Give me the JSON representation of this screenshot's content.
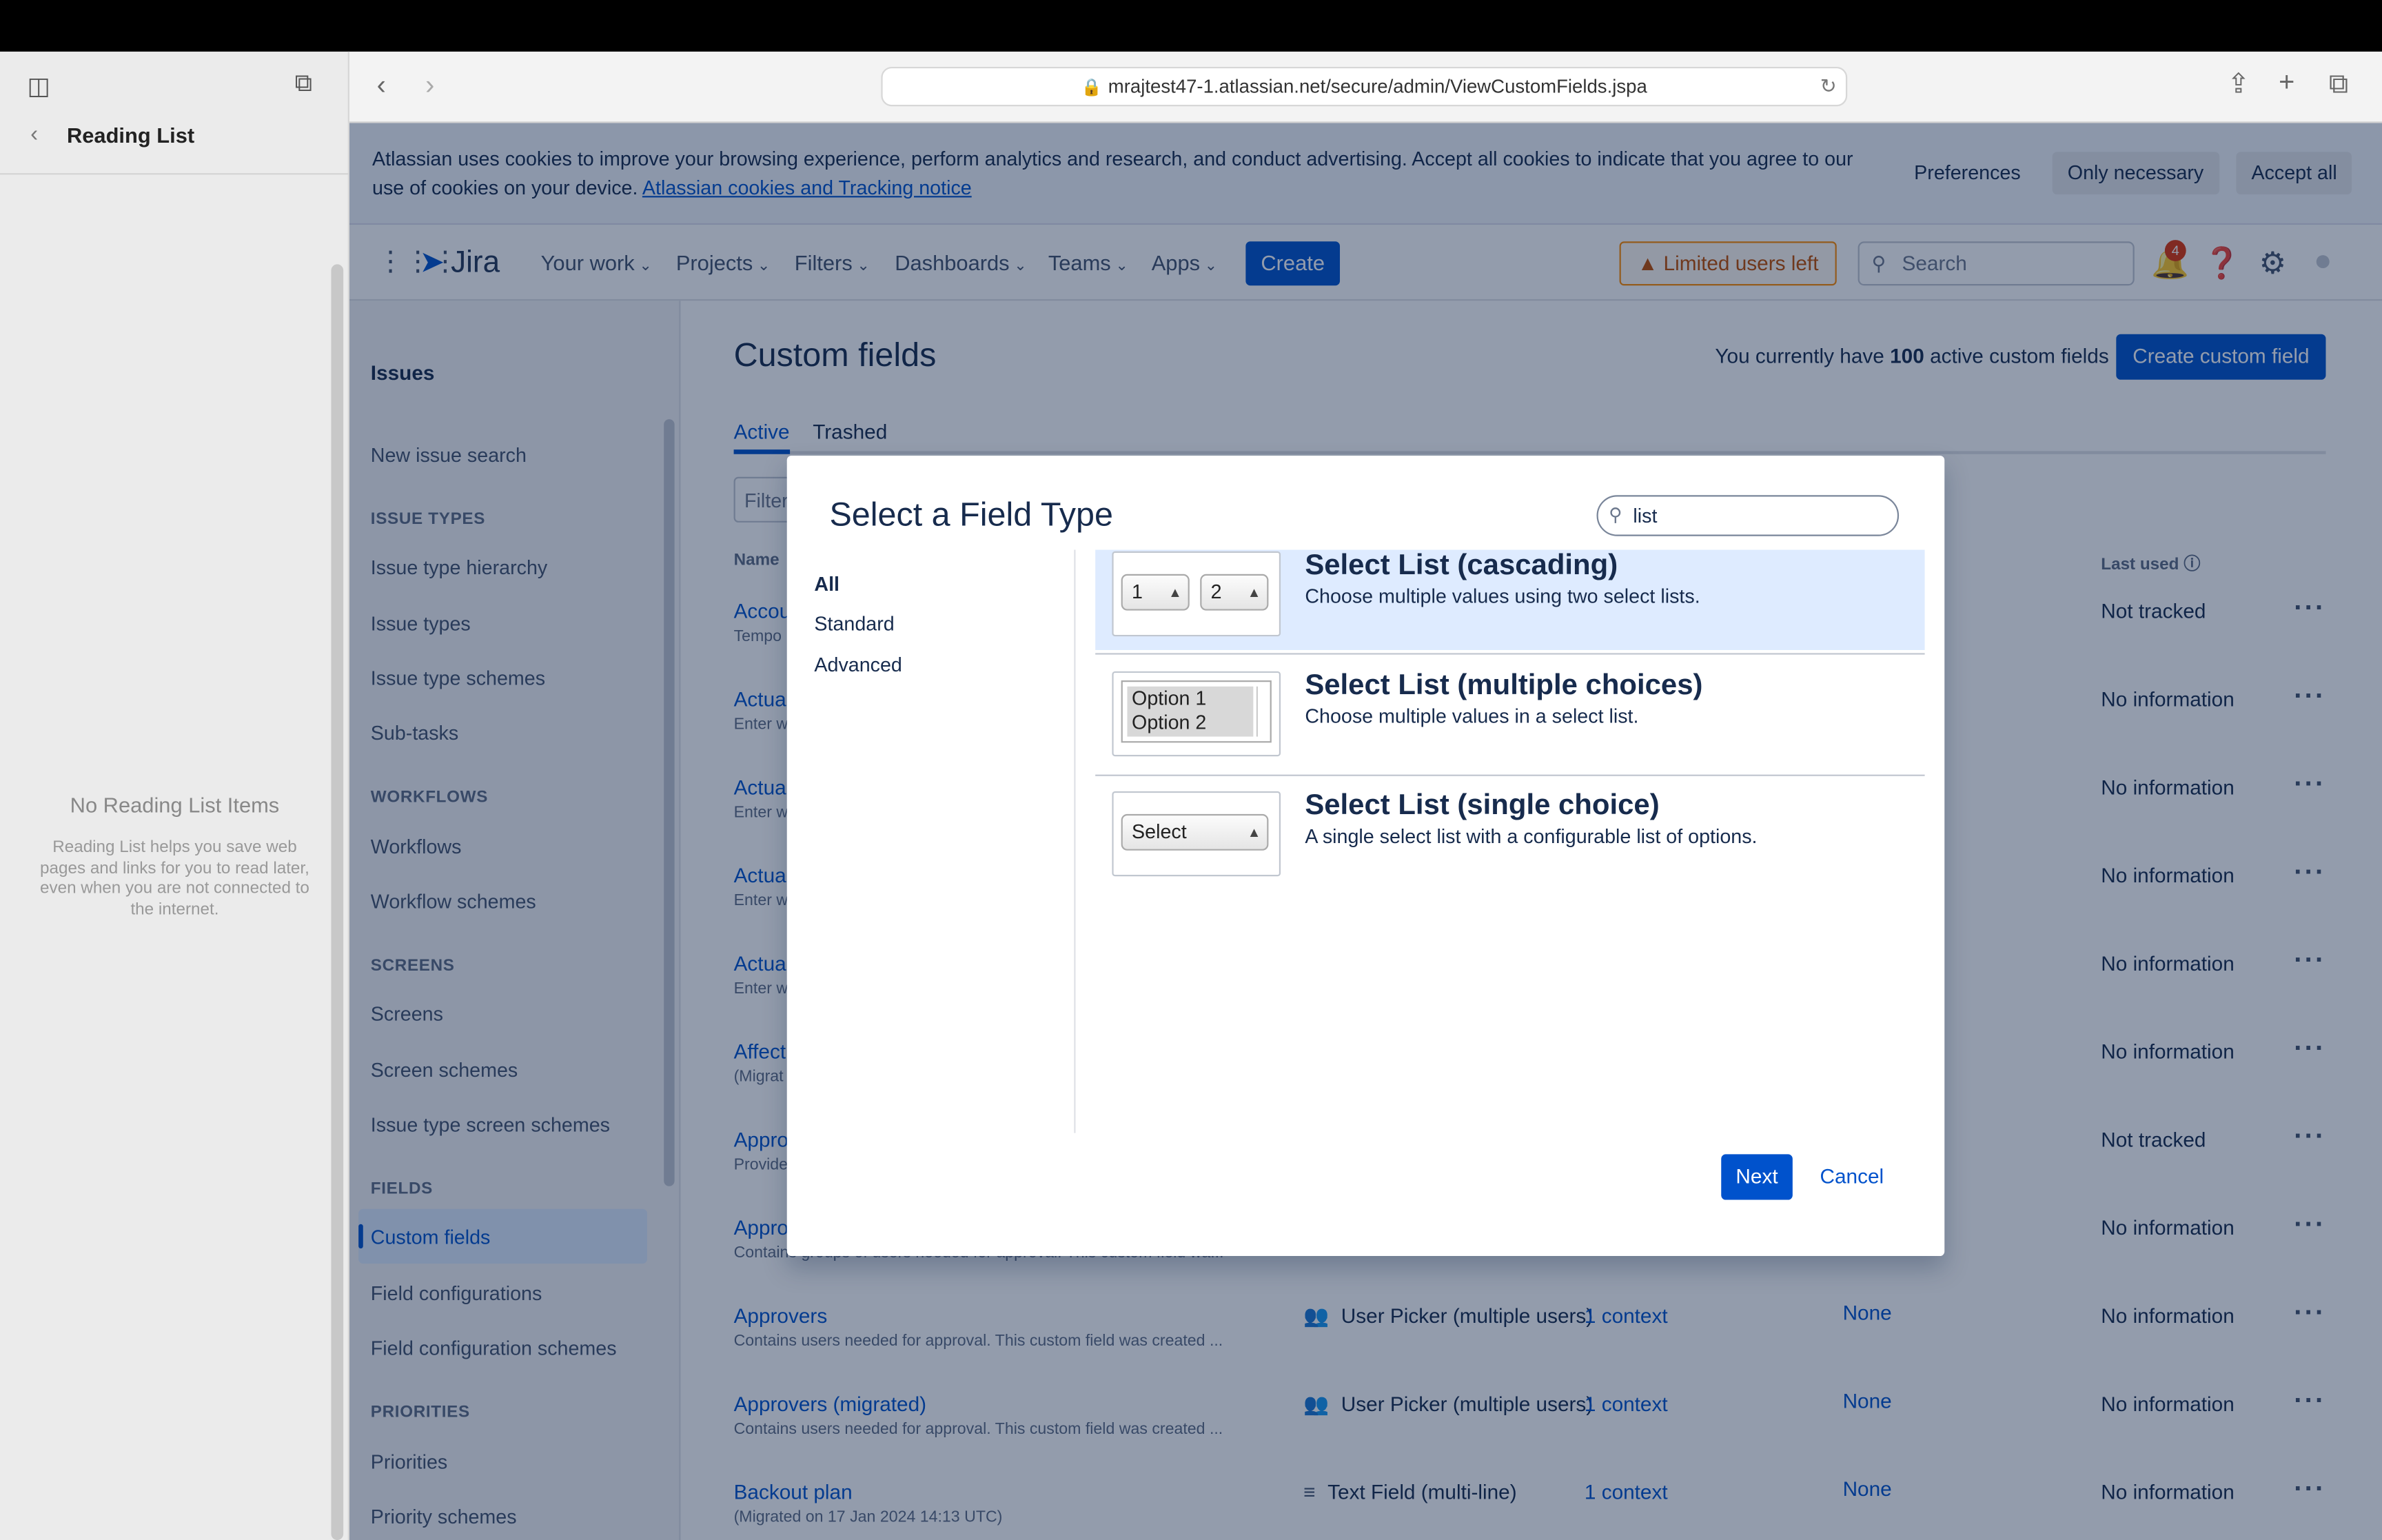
{
  "browser": {
    "url": "mrajtest47-1.atlassian.net/secure/admin/ViewCustomFields.jspa"
  },
  "reading_list": {
    "title": "Reading List",
    "empty_title": "No Reading List Items",
    "empty_text": "Reading List helps you save web pages and links for you to read later, even when you are not connected to the internet."
  },
  "cookie_banner": {
    "text": "Atlassian uses cookies to improve your browsing experience, perform analytics and research, and conduct advertising. Accept all cookies to indicate that you agree to our use of cookies on your device.",
    "link": "Atlassian cookies and Tracking notice",
    "preferences": "Preferences",
    "only_necessary": "Only necessary",
    "accept_all": "Accept all"
  },
  "nav": {
    "logo": "Jira",
    "items": [
      "Your work",
      "Projects",
      "Filters",
      "Dashboards",
      "Teams",
      "Apps"
    ],
    "create": "Create",
    "limited": "Limited users left",
    "search_placeholder": "Search",
    "notifications": "4"
  },
  "sidebar": {
    "title": "Issues",
    "new_issue_search": "New issue search",
    "groups": [
      {
        "heading": "ISSUE TYPES",
        "items": [
          "Issue type hierarchy",
          "Issue types",
          "Issue type schemes",
          "Sub-tasks"
        ]
      },
      {
        "heading": "WORKFLOWS",
        "items": [
          "Workflows",
          "Workflow schemes"
        ]
      },
      {
        "heading": "SCREENS",
        "items": [
          "Screens",
          "Screen schemes",
          "Issue type screen schemes"
        ]
      },
      {
        "heading": "FIELDS",
        "items": [
          "Custom fields",
          "Field configurations",
          "Field configuration schemes"
        ]
      },
      {
        "heading": "PRIORITIES",
        "items": [
          "Priorities",
          "Priority schemes"
        ]
      }
    ]
  },
  "content": {
    "title": "Custom fields",
    "count_prefix": "You currently have",
    "count": "100",
    "count_suffix": "active custom fields",
    "create_button": "Create custom field",
    "tabs": [
      "Active",
      "Trashed"
    ],
    "filter_placeholder": "Filter",
    "col_name": "Name",
    "col_last_used": "Last used",
    "rows": [
      {
        "name": "Accou",
        "desc": "Tempo",
        "last": "Not tracked"
      },
      {
        "name": "Actua",
        "desc": "Enter w",
        "last": "No information"
      },
      {
        "name": "Actua",
        "desc": "Enter w",
        "last": "No information"
      },
      {
        "name": "Actua",
        "desc": "Enter w",
        "last": "No information"
      },
      {
        "name": "Actua",
        "desc": "Enter w",
        "last": "No information"
      },
      {
        "name": "Affect",
        "desc": "(Migrat",
        "last": "No information"
      },
      {
        "name": "Appro",
        "desc": "Provide",
        "last": "Not tracked"
      },
      {
        "name": "Appro",
        "desc": "Contains groups of users needed for approval. This custom field wa...",
        "last": "No information"
      },
      {
        "name": "Approvers",
        "desc": "Contains users needed for approval. This custom field was created ...",
        "type": "User Picker (multiple users)",
        "ctx": "1 context",
        "screens": "None",
        "last": "No information"
      },
      {
        "name": "Approvers (migrated)",
        "desc": "Contains users needed for approval. This custom field was created ...",
        "type": "User Picker (multiple users)",
        "ctx": "1 context",
        "screens": "None",
        "last": "No information"
      },
      {
        "name": "Backout plan",
        "desc": "(Migrated on 17 Jan 2024 14:13 UTC)",
        "type": "Text Field (multi-line)",
        "ctx": "1 context",
        "screens": "None",
        "last": "No information"
      }
    ]
  },
  "dialog": {
    "title": "Select a Field Type",
    "search_value": "list",
    "categories": [
      "All",
      "Standard",
      "Advanced"
    ],
    "field_types": [
      {
        "name": "Select List (cascading)",
        "desc": "Choose multiple values using two select lists.",
        "preview": [
          "1",
          "2"
        ]
      },
      {
        "name": "Select List (multiple choices)",
        "desc": "Choose multiple values in a select list.",
        "preview": [
          "Option 1",
          "Option 2"
        ]
      },
      {
        "name": "Select List (single choice)",
        "desc": "A single select list with a configurable list of options.",
        "preview": [
          "Select"
        ]
      }
    ],
    "next": "Next",
    "cancel": "Cancel"
  }
}
